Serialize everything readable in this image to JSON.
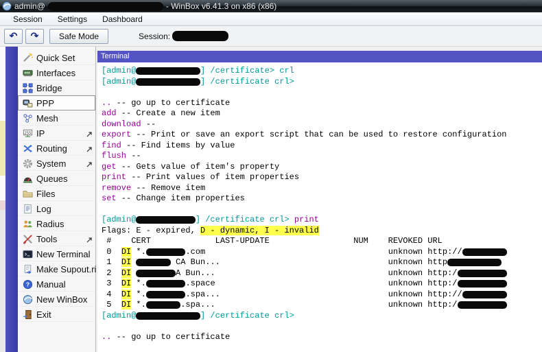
{
  "window": {
    "title_prefix": "admin@",
    "title_suffix": "- WinBox v6.41.3 on x86 (x86)"
  },
  "menubar": {
    "items": [
      "Session",
      "Settings",
      "Dashboard"
    ]
  },
  "toolbar": {
    "undo_icon": "↶",
    "redo_icon": "↷",
    "safe_mode_label": "Safe Mode",
    "session_label": "Session:"
  },
  "sidebar": {
    "items": [
      {
        "label": "Quick Set",
        "icon": "quickset-icon",
        "submenu": false,
        "selected": false
      },
      {
        "label": "Interfaces",
        "icon": "interfaces-icon",
        "submenu": false,
        "selected": false
      },
      {
        "label": "Bridge",
        "icon": "bridge-icon",
        "submenu": false,
        "selected": false
      },
      {
        "label": "PPP",
        "icon": "ppp-icon",
        "submenu": false,
        "selected": true
      },
      {
        "label": "Mesh",
        "icon": "mesh-icon",
        "submenu": false,
        "selected": false
      },
      {
        "label": "IP",
        "icon": "ip-icon",
        "submenu": true,
        "selected": false
      },
      {
        "label": "Routing",
        "icon": "routing-icon",
        "submenu": true,
        "selected": false
      },
      {
        "label": "System",
        "icon": "system-icon",
        "submenu": true,
        "selected": false
      },
      {
        "label": "Queues",
        "icon": "queues-icon",
        "submenu": false,
        "selected": false
      },
      {
        "label": "Files",
        "icon": "files-icon",
        "submenu": false,
        "selected": false
      },
      {
        "label": "Log",
        "icon": "log-icon",
        "submenu": false,
        "selected": false
      },
      {
        "label": "Radius",
        "icon": "radius-icon",
        "submenu": false,
        "selected": false
      },
      {
        "label": "Tools",
        "icon": "tools-icon",
        "submenu": true,
        "selected": false
      },
      {
        "label": "New Terminal",
        "icon": "terminal-icon",
        "submenu": false,
        "selected": false
      },
      {
        "label": "Make Supout.rif",
        "icon": "supout-icon",
        "submenu": false,
        "selected": false
      },
      {
        "label": "Manual",
        "icon": "manual-icon",
        "submenu": false,
        "selected": false
      },
      {
        "label": "New WinBox",
        "icon": "winbox-icon",
        "submenu": false,
        "selected": false
      },
      {
        "label": "Exit",
        "icon": "exit-icon",
        "submenu": false,
        "selected": false
      }
    ]
  },
  "terminal": {
    "title": "Terminal",
    "colors": {
      "prompt": "#009999",
      "command": "#990099",
      "text": "#000000",
      "highlight": "#ffff4d",
      "header_bg": "#5353c4"
    },
    "lines": [
      [
        {
          "t": "[admin@",
          "c": "p"
        },
        {
          "r": 13
        },
        {
          "t": "] /certificate> crl",
          "c": "p"
        }
      ],
      [
        {
          "t": "[admin@",
          "c": "p"
        },
        {
          "r": 13
        },
        {
          "t": "] /certificate crl>",
          "c": "p"
        }
      ],
      [],
      [
        {
          "t": "..",
          "c": "m"
        },
        {
          "t": " -- go up to certificate",
          "c": "k"
        }
      ],
      [
        {
          "t": "add",
          "c": "m"
        },
        {
          "t": " -- Create a new item",
          "c": "k"
        }
      ],
      [
        {
          "t": "download",
          "c": "m"
        },
        {
          "t": " --",
          "c": "k"
        }
      ],
      [
        {
          "t": "export",
          "c": "m"
        },
        {
          "t": " -- Print or save an export script that can be used to restore configuration",
          "c": "k"
        }
      ],
      [
        {
          "t": "find",
          "c": "m"
        },
        {
          "t": " -- Find items by value",
          "c": "k"
        }
      ],
      [
        {
          "t": "flush",
          "c": "m"
        },
        {
          "t": " --",
          "c": "k"
        }
      ],
      [
        {
          "t": "get",
          "c": "m"
        },
        {
          "t": " -- Gets value of item's property",
          "c": "k"
        }
      ],
      [
        {
          "t": "print",
          "c": "m"
        },
        {
          "t": " -- Print values of item properties",
          "c": "k"
        }
      ],
      [
        {
          "t": "remove",
          "c": "m"
        },
        {
          "t": " -- Remove item",
          "c": "k"
        }
      ],
      [
        {
          "t": "set",
          "c": "m"
        },
        {
          "t": " -- Change item properties",
          "c": "k"
        }
      ],
      [],
      [
        {
          "t": "[admin@",
          "c": "p"
        },
        {
          "r": 12
        },
        {
          "t": "] /certificate crl> ",
          "c": "p"
        },
        {
          "t": "print",
          "c": "m"
        }
      ],
      [
        {
          "t": "Flags: E - expired, ",
          "c": "k"
        },
        {
          "t": "D - dynamic, I - invalid",
          "c": "h"
        }
      ],
      [
        {
          "t": " #    CERT",
          "c": "k"
        },
        {
          "sp": 13
        },
        {
          "t": "LAST-UPDATE",
          "c": "k"
        },
        {
          "sp": 17
        },
        {
          "t": "NUM    REVOKED URL",
          "c": "k"
        }
      ],
      [
        {
          "t": " 0  ",
          "c": "k"
        },
        {
          "t": "DI",
          "c": "h"
        },
        {
          "t": " *.",
          "c": "k"
        },
        {
          "r": 8
        },
        {
          "t": ".com",
          "c": "k"
        },
        {
          "sp": 37
        },
        {
          "t": "unknown http://",
          "c": "k"
        },
        {
          "r": 9
        }
      ],
      [
        {
          "t": " 1  ",
          "c": "k"
        },
        {
          "t": "DI",
          "c": "h"
        },
        {
          "t": " ",
          "c": "k"
        },
        {
          "r": 7
        },
        {
          "t": " CA Bun...",
          "c": "k"
        },
        {
          "sp": 34
        },
        {
          "t": "unknown http",
          "c": "k"
        },
        {
          "r": 11
        }
      ],
      [
        {
          "t": " 2  ",
          "c": "k"
        },
        {
          "t": "DI",
          "c": "h"
        },
        {
          "t": " ",
          "c": "k"
        },
        {
          "r": 8
        },
        {
          "t": "A Bun...",
          "c": "k"
        },
        {
          "sp": 35
        },
        {
          "t": "unknown http:/",
          "c": "k"
        },
        {
          "r": 10
        }
      ],
      [
        {
          "t": " 3  ",
          "c": "k"
        },
        {
          "t": "DI",
          "c": "h"
        },
        {
          "t": " *.",
          "c": "k"
        },
        {
          "r": 8
        },
        {
          "t": ".space",
          "c": "k"
        },
        {
          "sp": 35
        },
        {
          "t": "unknown http:/",
          "c": "k"
        },
        {
          "r": 10
        }
      ],
      [
        {
          "t": " 4  ",
          "c": "k"
        },
        {
          "t": "DI",
          "c": "h"
        },
        {
          "t": " *.",
          "c": "k"
        },
        {
          "r": 8
        },
        {
          "t": ".spa...",
          "c": "k"
        },
        {
          "sp": 34
        },
        {
          "t": "unknown http://",
          "c": "k"
        },
        {
          "r": 9
        }
      ],
      [
        {
          "t": " 5  ",
          "c": "k"
        },
        {
          "t": "DI",
          "c": "h"
        },
        {
          "t": " *.",
          "c": "k"
        },
        {
          "r": 7
        },
        {
          "t": ".spa...",
          "c": "k"
        },
        {
          "sp": 35
        },
        {
          "t": "unknown http:/",
          "c": "k"
        },
        {
          "r": 10
        }
      ],
      [
        {
          "t": "[admin@",
          "c": "p"
        },
        {
          "r": 13
        },
        {
          "t": "] /certificate crl>",
          "c": "p"
        }
      ],
      [],
      [
        {
          "t": "..",
          "c": "m"
        },
        {
          "t": " -- go up to certificate",
          "c": "k"
        }
      ]
    ]
  }
}
